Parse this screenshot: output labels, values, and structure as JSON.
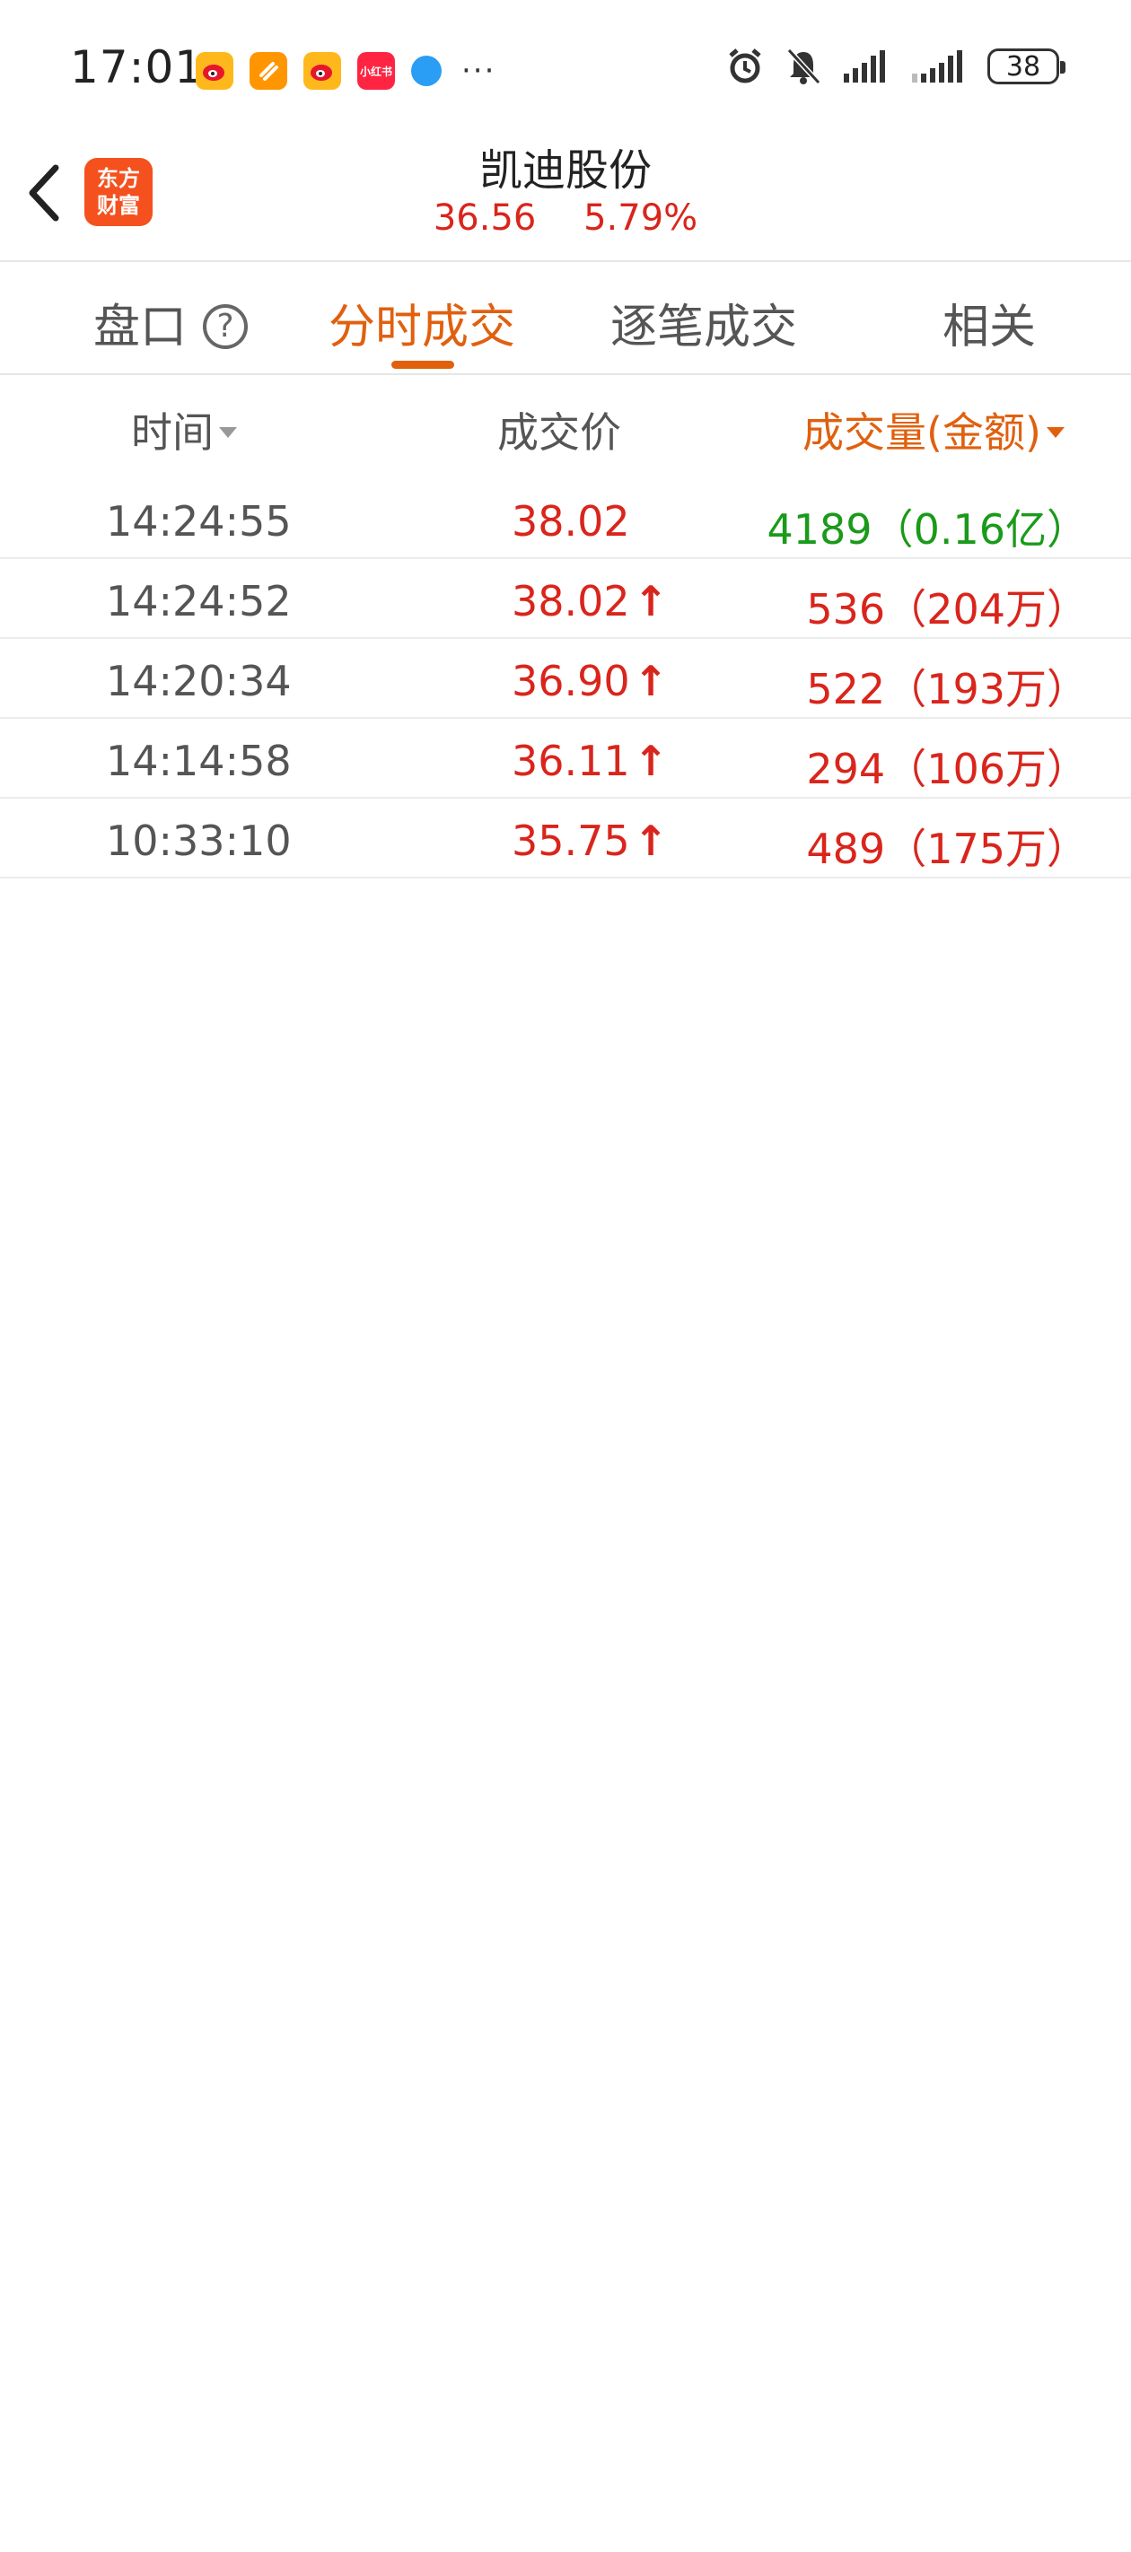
{
  "status_bar": {
    "time": "17:01",
    "battery": "38"
  },
  "header": {
    "back_icon": "chevron-left-icon",
    "logo_line1": "东方",
    "logo_line2": "财富",
    "title": "凯迪股份",
    "price": "36.56",
    "change_pct": "5.79%"
  },
  "tabs": [
    {
      "label": "盘口",
      "active": false
    },
    {
      "label": "分时成交",
      "active": true
    },
    {
      "label": "逐笔成交",
      "active": false
    },
    {
      "label": "相关",
      "active": false
    }
  ],
  "columns": {
    "time": "时间",
    "price": "成交价",
    "volume": "成交量(金额)"
  },
  "trades": [
    {
      "time": "14:24:55",
      "price": "38.02",
      "up": false,
      "volume": "4189（0.16亿）",
      "volume_color": "#1a9a1a"
    },
    {
      "time": "14:24:52",
      "price": "38.02",
      "up": true,
      "volume": "536（204万）",
      "volume_color": "#d9251c"
    },
    {
      "time": "14:20:34",
      "price": "36.90",
      "up": true,
      "volume": "522（193万）",
      "volume_color": "#d9251c"
    },
    {
      "time": "14:14:58",
      "price": "36.11",
      "up": true,
      "volume": "294（106万）",
      "volume_color": "#d9251c"
    },
    {
      "time": "10:33:10",
      "price": "35.75",
      "up": true,
      "volume": "489（175万）",
      "volume_color": "#d9251c"
    }
  ],
  "colors": {
    "accent": "#e0600e",
    "up_red": "#d9251c",
    "down_green": "#1a9a1a"
  }
}
